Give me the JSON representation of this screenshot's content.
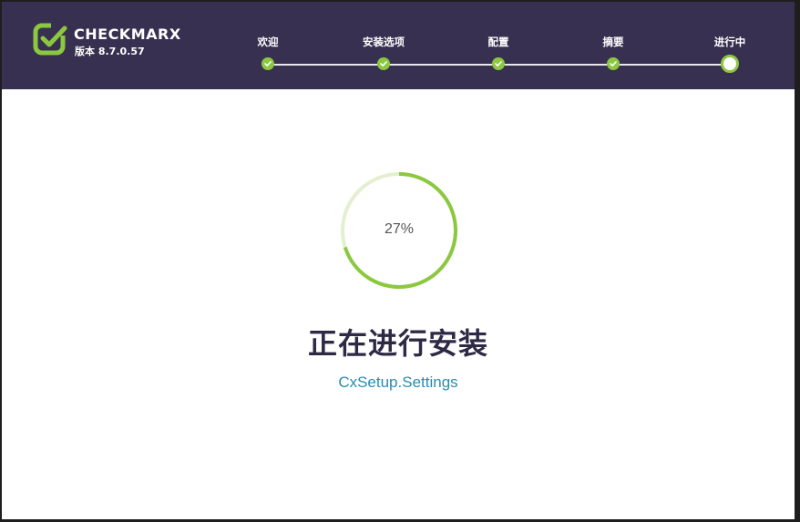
{
  "header": {
    "brand": "CHECKMARX",
    "version_label": "版本 8.7.0.57"
  },
  "steps": [
    {
      "label": "欢迎",
      "state": "done"
    },
    {
      "label": "安装选项",
      "state": "done"
    },
    {
      "label": "配置",
      "state": "done"
    },
    {
      "label": "摘要",
      "state": "done"
    },
    {
      "label": "进行中",
      "state": "current"
    }
  ],
  "progress": {
    "percent_text": "27%",
    "value": 0.27
  },
  "main": {
    "title": "正在进行安装",
    "status": "CxSetup.Settings"
  },
  "colors": {
    "header_bg": "#383050",
    "accent_green": "#8cc83f",
    "title_color": "#2e2a45",
    "status_blue": "#2a8bb5"
  }
}
